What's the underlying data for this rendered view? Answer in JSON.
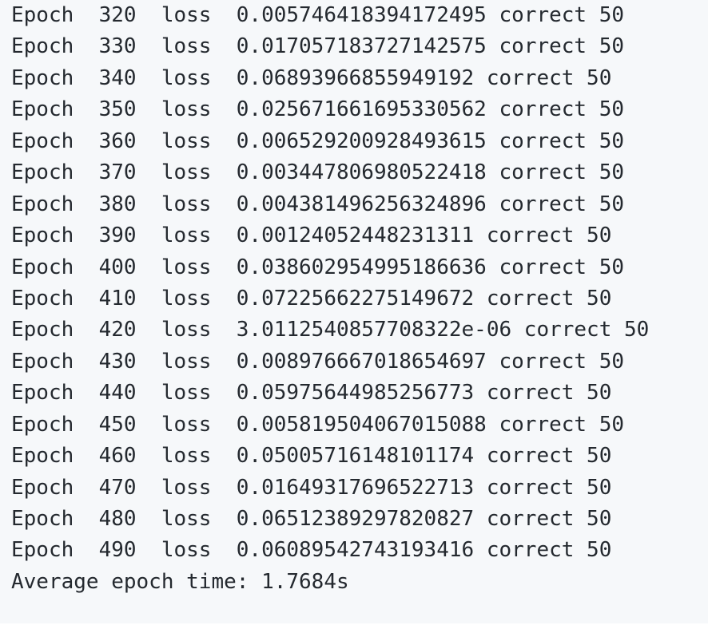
{
  "output": {
    "lines": [
      "Epoch  320  loss  0.005746418394172495 correct 50",
      "Epoch  330  loss  0.017057183727142575 correct 50",
      "Epoch  340  loss  0.06893966855949192 correct 50",
      "Epoch  350  loss  0.025671661695330562 correct 50",
      "Epoch  360  loss  0.006529200928493615 correct 50",
      "Epoch  370  loss  0.003447806980522418 correct 50",
      "Epoch  380  loss  0.004381496256324896 correct 50",
      "Epoch  390  loss  0.00124052448231311 correct 50",
      "Epoch  400  loss  0.038602954995186636 correct 50",
      "Epoch  410  loss  0.07225662275149672 correct 50",
      "Epoch  420  loss  3.0112540857708322e-06 correct 50",
      "Epoch  430  loss  0.008976667018654697 correct 50",
      "Epoch  440  loss  0.05975644985256773 correct 50",
      "Epoch  450  loss  0.005819504067015088 correct 50",
      "Epoch  460  loss  0.05005716148101174 correct 50",
      "Epoch  470  loss  0.01649317696522713 correct 50",
      "Epoch  480  loss  0.06512389297820827 correct 50",
      "Epoch  490  loss  0.06089542743193416 correct 50"
    ],
    "summary": "Average epoch time: 1.7684s"
  },
  "colors": {
    "panel_background": "#f6f8fa",
    "text": "#24292f"
  }
}
